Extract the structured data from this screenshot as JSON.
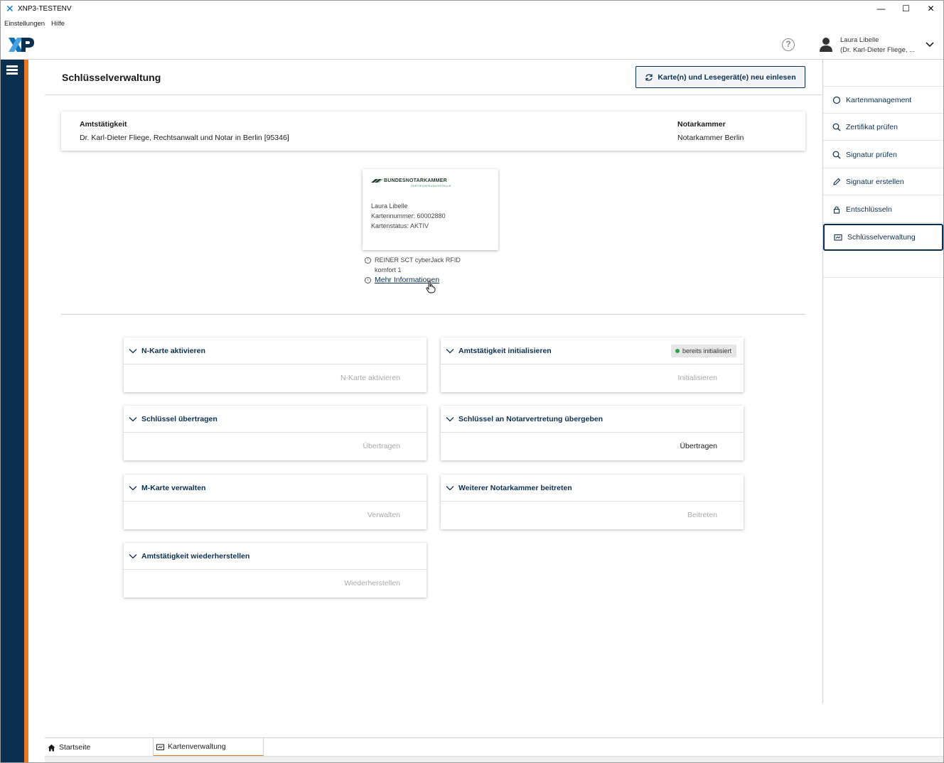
{
  "window": {
    "title": "XNP3-TESTENV",
    "minimize_glyph": "—",
    "maximize_glyph": "☐",
    "close_glyph": "✕"
  },
  "menu": {
    "items": [
      "Einstellungen",
      "Hilfe"
    ]
  },
  "header": {
    "logo_text": "XP",
    "help_glyph": "?",
    "user_name": "Laura Libelle",
    "user_org": "(Dr. Karl-Dieter Fliege, ..."
  },
  "page": {
    "title": "Schlüsselverwaltung",
    "reload_button": "Karte(n) und Lesegerät(e) neu einlesen"
  },
  "office": {
    "amt_label": "Amtstätigkeit",
    "amt_value": "Dr. Karl-Dieter Fliege, Rechtsanwalt und Notar in Berlin [95346]",
    "kammer_label": "Notarkammer",
    "kammer_value": "Notarkammer Berlin"
  },
  "card": {
    "issuer": "BUNDESNOTARKAMMER",
    "issuer_sub": "ZERTIFIZIERUNGSSTELLE",
    "holder": "Laura Libelle",
    "number": "Kartennummer: 60002880",
    "status": "Kartenstatus: AKTIV",
    "reader_line1": "REINER SCT cyberJack RFID",
    "reader_line2": "komfort 1",
    "more_info": "Mehr Informationen",
    "info_glyph": "i"
  },
  "panels": [
    {
      "title": "N-Karte aktivieren",
      "action": "N-Karte aktivieren",
      "enabled": false
    },
    {
      "title": "Amtstätigkeit initialisieren",
      "action": "Initialisieren",
      "enabled": false,
      "badge": "bereits initialisiert"
    },
    {
      "title": "Schlüssel übertragen",
      "action": "Übertragen",
      "enabled": false
    },
    {
      "title": "Schlüssel an Notarvertretung übergeben",
      "action": "Übertragen",
      "enabled": true
    },
    {
      "title": "M-Karte verwalten",
      "action": "Verwalten",
      "enabled": false
    },
    {
      "title": "Weiterer Notarkammer beitreten",
      "action": "Beitreten",
      "enabled": false
    },
    {
      "title": "Amtstätigkeit wiederherstellen",
      "action": "Wiederherstellen",
      "enabled": false
    }
  ],
  "sidebar": {
    "items": [
      {
        "label": "Kartenmanagement",
        "icon": "circle-icon"
      },
      {
        "label": "Zertifikat prüfen",
        "icon": "search-icon"
      },
      {
        "label": "Signatur prüfen",
        "icon": "search-icon"
      },
      {
        "label": "Signatur erstellen",
        "icon": "pen-icon"
      },
      {
        "label": "Entschlüsseln",
        "icon": "lock-icon"
      },
      {
        "label": "Schlüsselverwaltung",
        "icon": "key-card-icon",
        "active": true
      }
    ]
  },
  "tabs": [
    {
      "label": "Startseite",
      "icon": "home-icon"
    },
    {
      "label": "Kartenverwaltung",
      "icon": "card-icon",
      "active": true
    }
  ],
  "colors": {
    "navy": "#0b2f4f",
    "accent_orange": "#e87722",
    "status_green": "#2ea44f"
  }
}
